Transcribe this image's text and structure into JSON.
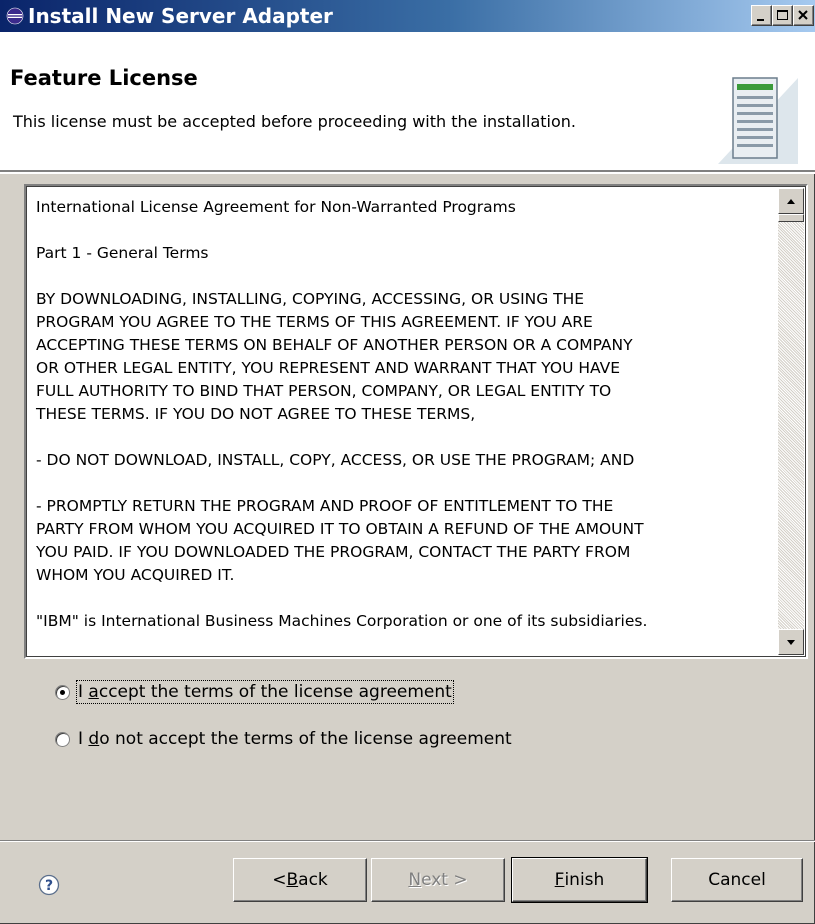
{
  "window": {
    "title": "Install New Server Adapter",
    "controls": {
      "minimize": "minimize",
      "maximize": "maximize",
      "close": "close"
    }
  },
  "banner": {
    "title": "Feature License",
    "description": "This license must be accepted before proceeding with the installation.",
    "icon": "server-icon"
  },
  "license": {
    "paragraphs": [
      "International License Agreement for Non-Warranted Programs",
      "Part 1 - General Terms",
      "BY DOWNLOADING, INSTALLING, COPYING, ACCESSING, OR USING THE\nPROGRAM YOU AGREE TO THE TERMS OF THIS AGREEMENT. IF YOU ARE\nACCEPTING THESE TERMS ON BEHALF OF ANOTHER PERSON OR A COMPANY\nOR OTHER LEGAL ENTITY, YOU REPRESENT AND WARRANT THAT YOU HAVE\nFULL AUTHORITY TO BIND THAT PERSON, COMPANY, OR LEGAL ENTITY TO\nTHESE TERMS. IF YOU DO NOT AGREE TO THESE TERMS,",
      "- DO NOT DOWNLOAD, INSTALL, COPY, ACCESS, OR USE THE PROGRAM; AND",
      "- PROMPTLY RETURN THE PROGRAM AND PROOF OF ENTITLEMENT TO THE\nPARTY FROM WHOM YOU ACQUIRED IT TO OBTAIN A REFUND OF THE AMOUNT\nYOU PAID. IF YOU DOWNLOADED THE PROGRAM, CONTACT THE PARTY FROM\nWHOM YOU ACQUIRED IT.",
      "\"IBM\" is International Business Machines Corporation or one of its subsidiaries."
    ]
  },
  "options": {
    "accept": {
      "prefix": "I ",
      "mnemonic": "a",
      "rest": "ccept the terms of the license agreement",
      "checked": true
    },
    "decline": {
      "prefix": "I ",
      "mnemonic": "d",
      "rest": "o not accept the terms of the license agreement",
      "checked": false
    }
  },
  "buttons": {
    "back": {
      "prefix": "< ",
      "mnemonic": "B",
      "rest": "ack"
    },
    "next": {
      "prefix": "",
      "mnemonic": "N",
      "rest": "ext >",
      "disabled": true
    },
    "finish": {
      "prefix": "",
      "mnemonic": "F",
      "rest": "inish"
    },
    "cancel": {
      "label": "Cancel"
    }
  },
  "colors": {
    "titlebar_start": "#0a246a",
    "titlebar_end": "#a6caf0",
    "dialog_bg": "#d4d0c8"
  }
}
